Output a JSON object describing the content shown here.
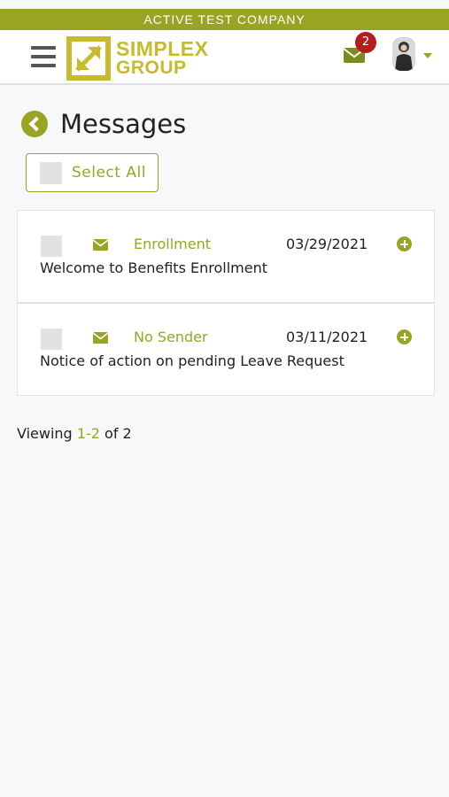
{
  "company": {
    "name": "ACTIVE TEST COMPANY"
  },
  "header": {
    "logo_line1": "SIMPLEX",
    "logo_line2": "GROUP",
    "mail_badge_count": "2"
  },
  "page": {
    "title": "Messages",
    "select_all_label": "Select All"
  },
  "messages": [
    {
      "sender": "Enrollment",
      "date": "03/29/2021",
      "subject": "Welcome to Benefits Enrollment"
    },
    {
      "sender": "No Sender",
      "date": "03/11/2021",
      "subject": "Notice of action on pending Leave Request"
    }
  ],
  "pagination": {
    "prefix": "Viewing",
    "range": "1-2",
    "suffix": "of 2"
  },
  "colors": {
    "accent": "#9aa424",
    "logo": "#c7ba2c",
    "badge": "#b31d1d"
  },
  "icons": {
    "menu": "hamburger-icon",
    "mail": "envelope-icon",
    "back": "chevron-left-icon",
    "expand": "plus-circle-icon"
  }
}
